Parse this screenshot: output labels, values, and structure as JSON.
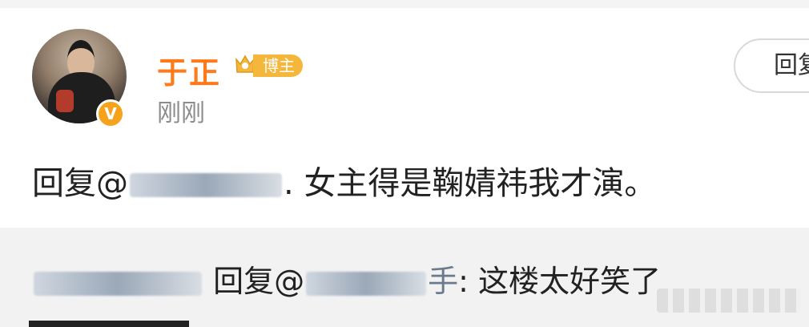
{
  "post": {
    "username": "于正",
    "badge_label": "博主",
    "time": "刚刚",
    "reply_button": "回复",
    "content": {
      "prefix": "回复@",
      "dot": ".",
      "text": "女主得是鞠婧祎我才演。"
    }
  },
  "comment": {
    "reply_prefix": "回复@",
    "mention_tail": "手",
    "text": ": 这楼太好笑了"
  },
  "colors": {
    "username": "#ff7a1a",
    "badge": "#f5b73b",
    "verify": "#f7a21b"
  }
}
